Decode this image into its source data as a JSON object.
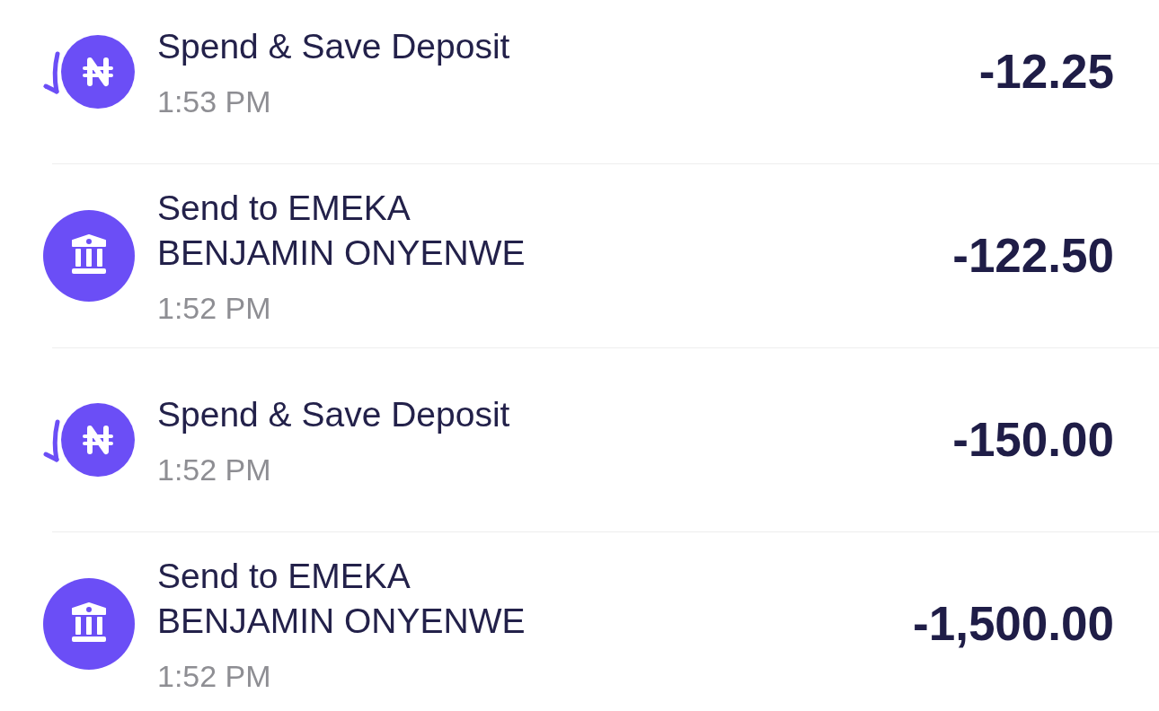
{
  "transactions": [
    {
      "kind": "deposit",
      "title": "Spend & Save Deposit",
      "time": "1:53 PM",
      "amount": "-12.25"
    },
    {
      "kind": "transfer",
      "title": "Send to EMEKA BENJAMIN ONYENWE",
      "time": "1:52 PM",
      "amount": "-122.50"
    },
    {
      "kind": "deposit",
      "title": "Spend & Save Deposit",
      "time": "1:52 PM",
      "amount": "-150.00"
    },
    {
      "kind": "transfer",
      "title": "Send to EMEKA BENJAMIN ONYENWE",
      "time": "1:52 PM",
      "amount": "-1,500.00"
    }
  ]
}
